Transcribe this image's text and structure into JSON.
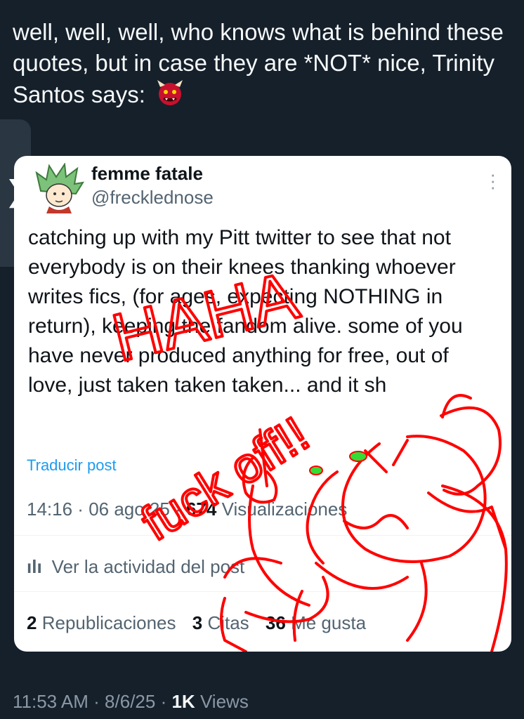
{
  "tweet": {
    "text": "well, well, well, who knows what is behind these quotes, but in case they are *NOT* nice, Trinity Santos says:",
    "emoji": "ogre-face"
  },
  "quoted": {
    "name": "femme fatale",
    "handle": "@frecklednose",
    "body": "catching up with my Pitt twitter to see that not everybody is on their knees thanking whoever writes fics, (for ages, expecting NOTHING in return), keeping the fandom alive. some of you have never produced anything for free, out of love, just taken taken taken... and it sh",
    "translate_label": "Traducir post",
    "time": "14:16",
    "date": "06 ago 25",
    "views_count": "674",
    "views_label": "Visualizaciones",
    "activity_icon": "analytics-bars-icon",
    "activity_label": "Ver la actividad del post",
    "reposts_count": "2",
    "reposts_label": "Republicaciones",
    "quotes_count": "3",
    "quotes_label": "Citas",
    "likes_count": "36",
    "likes_label": "Me gusta"
  },
  "drawing": {
    "words": [
      "HAHA",
      "fuck off!!"
    ],
    "color": "#ff0000"
  },
  "footer": {
    "time": "11:53 AM",
    "date": "8/6/25",
    "views_count": "1K",
    "views_label": "Views"
  },
  "nav": {
    "chevron": "❯"
  },
  "colors": {
    "background": "#15202b",
    "card": "#ffffff",
    "link": "#1d9bf0",
    "scribble": "#ff0000"
  }
}
